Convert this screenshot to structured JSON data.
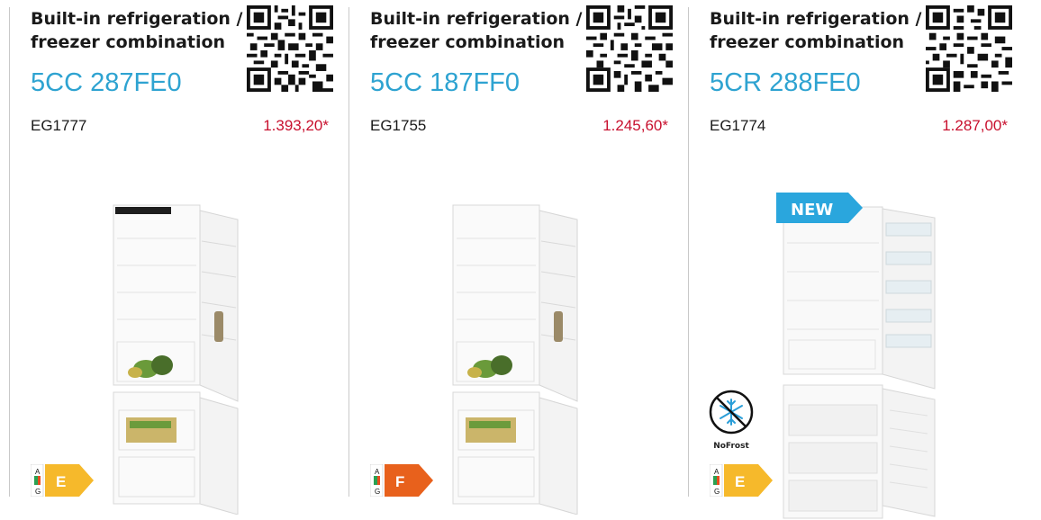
{
  "products": [
    {
      "category_line1": "Built-in refrigeration /",
      "category_line2": "freezer combination",
      "model": "5CC 287FE0",
      "code": "EG1777",
      "price": "1.393,20*",
      "energy_class": "E",
      "energy_scale_top": "A",
      "energy_scale_bottom": "G",
      "energy_color": "#f6b92b",
      "badge": "",
      "feature": ""
    },
    {
      "category_line1": "Built-in refrigeration /",
      "category_line2": "freezer combination",
      "model": "5CC 187FF0",
      "code": "EG1755",
      "price": "1.245,60*",
      "energy_class": "F",
      "energy_scale_top": "A",
      "energy_scale_bottom": "G",
      "energy_color": "#e8611c",
      "badge": "",
      "feature": ""
    },
    {
      "category_line1": "Built-in refrigeration /",
      "category_line2": "freezer combination",
      "model": "5CR 288FE0",
      "code": "EG1774",
      "price": "1.287,00*",
      "energy_class": "E",
      "energy_scale_top": "A",
      "energy_scale_bottom": "G",
      "energy_color": "#f6b92b",
      "badge": "NEW",
      "feature": "NoFrost"
    }
  ],
  "colors": {
    "model": "#2ea3d1",
    "price": "#c8102e",
    "badge": "#2aa6dd"
  }
}
